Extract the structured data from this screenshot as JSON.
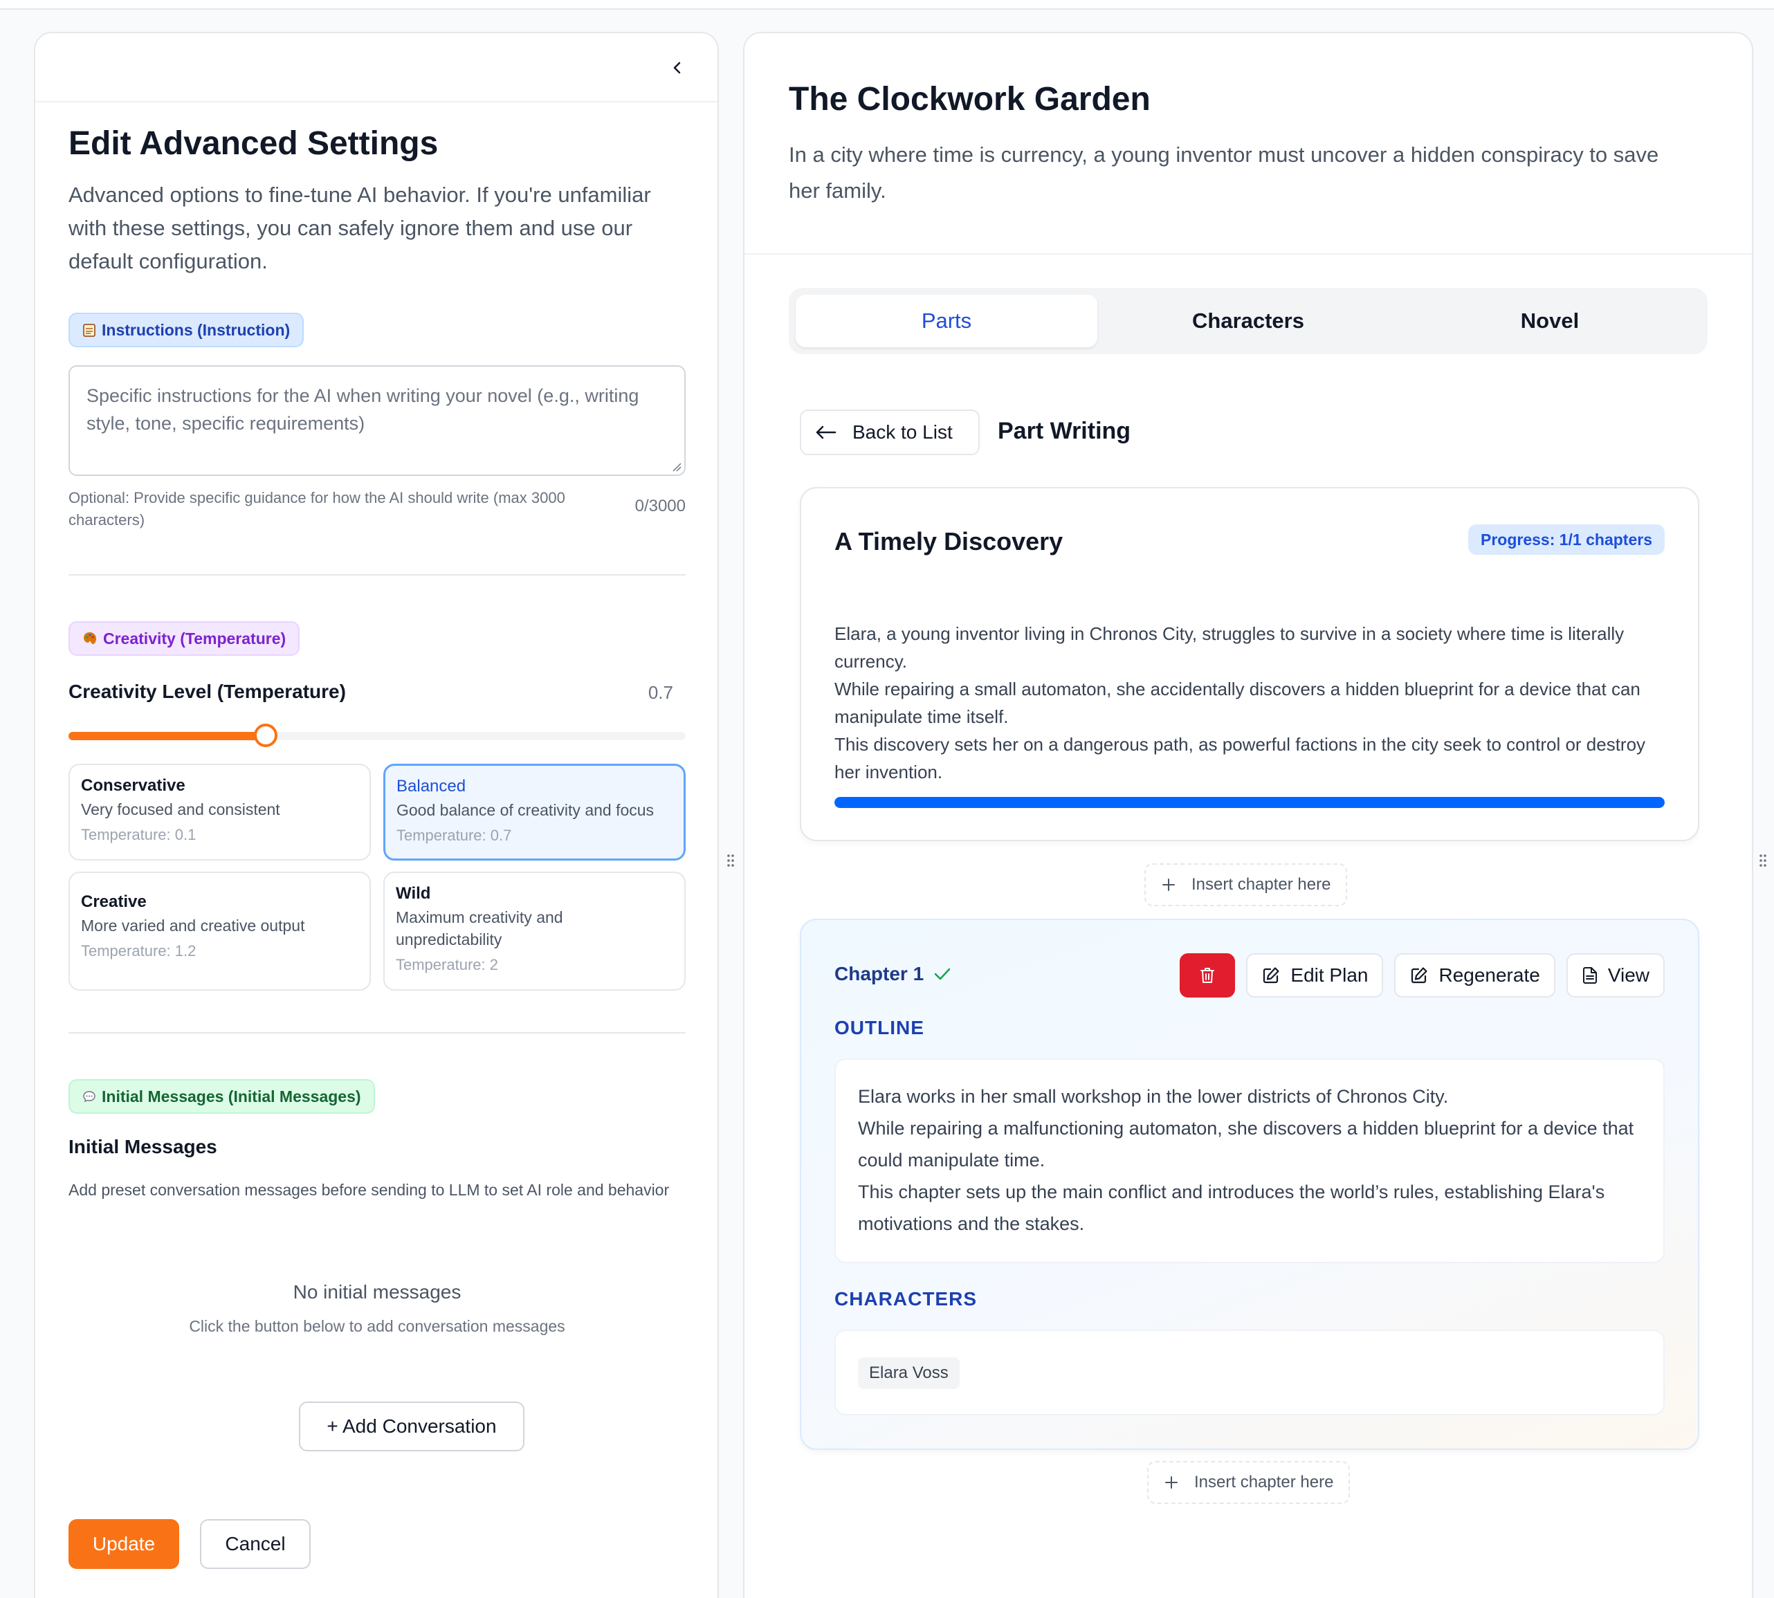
{
  "settings": {
    "title": "Edit Advanced Settings",
    "description": "Advanced options to fine-tune AI behavior. If you're unfamiliar with these settings, you can safely ignore them and use our default configuration.",
    "instructions": {
      "pill": "Instructions (Instruction)",
      "placeholder": "Specific instructions for the AI when writing your novel (e.g., writing style, tone, specific requirements)",
      "hint": "Optional: Provide specific guidance for how the AI should write (max 3000 characters)",
      "counter": "0/3000"
    },
    "creativity": {
      "pill": "Creativity (Temperature)",
      "label": "Creativity Level (Temperature)",
      "value_text": "0.7",
      "slider_fraction": 0.32,
      "options": [
        {
          "title": "Conservative",
          "desc": "Very focused and consistent",
          "temp": "Temperature: 0.1",
          "selected": false
        },
        {
          "title": "Balanced",
          "desc": "Good balance of creativity and focus",
          "temp": "Temperature: 0.7",
          "selected": true
        },
        {
          "title": "Creative",
          "desc": "More varied and creative output",
          "temp": "Temperature: 1.2",
          "selected": false
        },
        {
          "title": "Wild",
          "desc": "Maximum creativity and unpredictability",
          "temp": "Temperature: 2",
          "selected": false
        }
      ]
    },
    "initial_messages": {
      "pill": "Initial Messages (Initial Messages)",
      "heading": "Initial Messages",
      "desc": "Add preset conversation messages before sending to LLM to set AI role and behavior",
      "empty_title": "No initial messages",
      "empty_desc": "Click the button below to add conversation messages",
      "add_button": "+ Add Conversation"
    },
    "update_button": "Update",
    "cancel_button": "Cancel"
  },
  "novel": {
    "title": "The Clockwork Garden",
    "description": "In a city where time is currency, a young inventor must uncover a hidden conspiracy to save her family.",
    "tabs": [
      {
        "label": "Parts",
        "active": true
      },
      {
        "label": "Characters",
        "active": false
      },
      {
        "label": "Novel",
        "active": false
      }
    ],
    "back_button": "Back to List",
    "section_title": "Part Writing",
    "part": {
      "title": "A Timely Discovery",
      "progress_badge": "Progress: 1/1 chapters",
      "progress_fraction": 1.0,
      "summary": [
        "Elara, a young inventor living in Chronos City, struggles to survive in a society where time is literally currency.",
        "While repairing a small automaton, she accidentally discovers a hidden blueprint for a device that can manipulate time itself.",
        "This discovery sets her on a dangerous path, as powerful factions in the city seek to control or destroy her invention."
      ]
    },
    "insert_label": "Insert chapter here",
    "chapter": {
      "title": "Chapter 1",
      "edit_plan": "Edit Plan",
      "regenerate": "Regenerate",
      "view": "View",
      "outline_label": "OUTLINE",
      "outline": [
        "Elara works in her small workshop in the lower districts of Chronos City.",
        "While repairing a malfunctioning automaton, she discovers a hidden blueprint for a device that could manipulate time.",
        "This chapter sets up the main conflict and introduces the world’s rules, establishing Elara's motivations and the stakes."
      ],
      "characters_label": "CHARACTERS",
      "characters": [
        "Elara Voss"
      ]
    }
  },
  "colors": {
    "accent_orange": "#f97316",
    "accent_blue": "#1d4ed8",
    "progress_blue": "#0066ff",
    "danger_red": "#e11d2e"
  }
}
